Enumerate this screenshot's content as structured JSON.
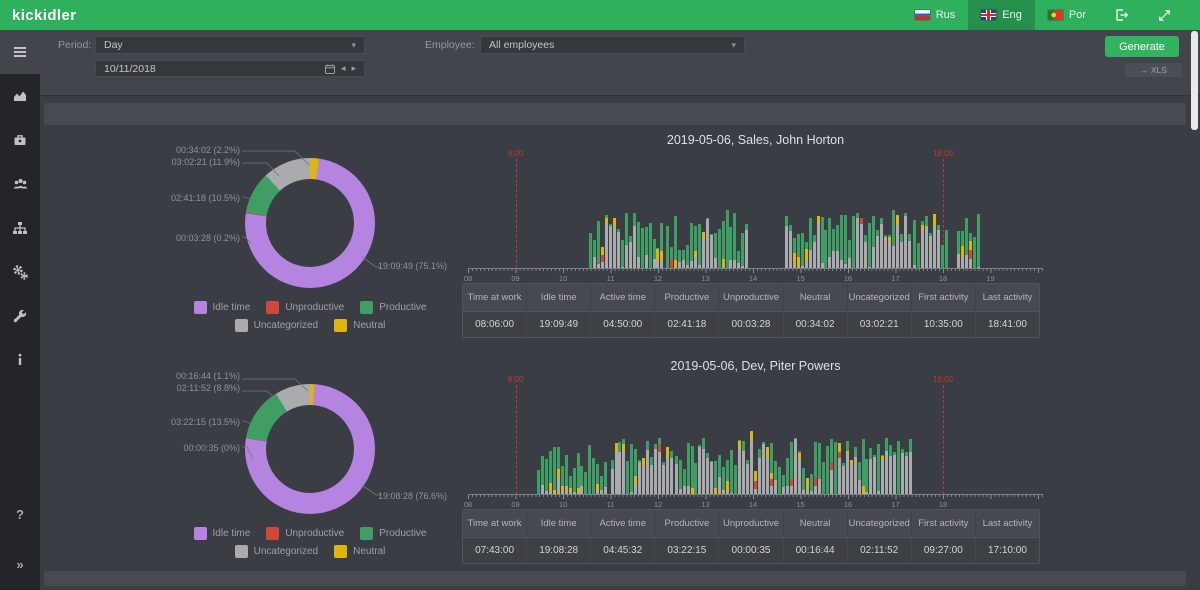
{
  "header": {
    "logo": "kickidler",
    "languages": [
      {
        "label": "Rus",
        "active": false
      },
      {
        "label": "Eng",
        "active": true
      },
      {
        "label": "Por",
        "active": false
      }
    ]
  },
  "sidebar": {
    "items": [
      {
        "name": "reports",
        "active": true
      },
      {
        "name": "charts",
        "active": false
      },
      {
        "name": "violations",
        "active": false
      },
      {
        "name": "employees",
        "active": false
      },
      {
        "name": "structure",
        "active": false
      },
      {
        "name": "settings",
        "active": false
      },
      {
        "name": "tools",
        "active": false
      },
      {
        "name": "info",
        "active": false
      }
    ],
    "help_glyph": "?",
    "collapse_glyph": "»"
  },
  "filters": {
    "period_label": "Period:",
    "period_value": "Day",
    "date_value": "10/11/2018",
    "employee_label": "Employee:",
    "employee_value": "All employees",
    "generate_label": "Generate",
    "xls_label": "→ XLS",
    "date_prev": "◂",
    "date_next": "▸"
  },
  "legend": {
    "items": [
      {
        "label": "Idle time",
        "color": "#b584e0"
      },
      {
        "label": "Unproductive",
        "color": "#d0483a"
      },
      {
        "label": "Productive",
        "color": "#3f9e63"
      },
      {
        "label": "Uncategorized",
        "color": "#a9abad"
      },
      {
        "label": "Neutral",
        "color": "#dcb50e"
      }
    ]
  },
  "reports": [
    {
      "title": "2019-05-06, Sales, John Horton",
      "callouts": [
        "00:34:02 (2.2%)",
        "03:02:21 (11.9%)",
        "02:41:18 (10.5%)",
        "00:03:28 (0.2%)",
        "19:09:49 (75.1%)"
      ],
      "table": {
        "headers": [
          "Time at work",
          "Idle time",
          "Active time",
          "Productive",
          "Unproductive",
          "Neutral",
          "Uncategorized",
          "First activity",
          "Last activity"
        ],
        "values": [
          "08:06:00",
          "19:09:49",
          "04:50:00",
          "02:41:18",
          "00:03:28",
          "00:34:02",
          "03:02:21",
          "10:35:00",
          "18:41:00"
        ]
      }
    },
    {
      "title": "2019-05-06, Dev, Piter Powers",
      "callouts": [
        "00:16:44 (1.1%)",
        "02:11:52 (8.8%)",
        "03:22:15 (13.5%)",
        "00:00:35 (0%)",
        "19:08:28 (76.6%)"
      ],
      "table": {
        "headers": [
          "Time at work",
          "Idle time",
          "Active time",
          "Productive",
          "Unproductive",
          "Neutral",
          "Uncategorized",
          "First activity",
          "Last activity"
        ],
        "values": [
          "07:43:00",
          "19:08:28",
          "04:45:32",
          "03:22:15",
          "00:00:35",
          "00:16:44",
          "02:11:52",
          "09:27:00",
          "17:10:00"
        ]
      }
    }
  ],
  "chart_data": [
    {
      "type": "pie",
      "donut": true,
      "title": "2019-05-06, Sales, John Horton — working time distribution",
      "labels": [
        "Neutral",
        "Idle time",
        "Unproductive",
        "Productive",
        "Uncategorized"
      ],
      "values_pct": [
        2.2,
        75.1,
        0.2,
        10.5,
        11.9
      ],
      "values_time": [
        "00:34:02",
        "19:09:49",
        "00:03:28",
        "02:41:18",
        "03:02:21"
      ],
      "colors": [
        "#dcb50e",
        "#b584e0",
        "#d0483a",
        "#3f9e63",
        "#a9abad"
      ],
      "legend_position": "bottom"
    },
    {
      "type": "bar",
      "subtype": "stacked-activity-timeline",
      "title": "2019-05-06, Sales, John Horton — activity by time of day",
      "x_axis": {
        "start": 8,
        "end": 20,
        "hour_labels": [
          "08",
          "09",
          "10",
          "11",
          "12",
          "13",
          "14",
          "15",
          "16",
          "17",
          "18",
          "19"
        ]
      },
      "bar_interval_min": 5,
      "activity_hours": [
        [
          10.55,
          12.08
        ],
        [
          12.17,
          13.92
        ],
        [
          14.67,
          17.28
        ],
        [
          17.37,
          18.05
        ],
        [
          18.3,
          18.72
        ]
      ],
      "schedule_lines": [
        {
          "hour": 9,
          "label": "9:00"
        },
        {
          "hour": 18,
          "label": "18:00"
        }
      ],
      "series_colors": {
        "productive": "#3f9e63",
        "uncategorized": "#a9abad",
        "neutral": "#dcb50e",
        "unproductive": "#d0483a"
      },
      "seed": 42
    },
    {
      "type": "pie",
      "donut": true,
      "title": "2019-05-06, Dev, Piter Powers — working time distribution",
      "labels": [
        "Neutral",
        "Idle time",
        "Unproductive",
        "Productive",
        "Uncategorized"
      ],
      "values_pct": [
        1.1,
        76.6,
        0.1,
        13.5,
        8.8
      ],
      "values_time": [
        "00:16:44",
        "19:08:28",
        "00:00:35",
        "03:22:15",
        "02:11:52"
      ],
      "colors": [
        "#dcb50e",
        "#b584e0",
        "#d0483a",
        "#3f9e63",
        "#a9abad"
      ],
      "legend_position": "bottom"
    },
    {
      "type": "bar",
      "subtype": "stacked-activity-timeline",
      "title": "2019-05-06, Dev, Piter Powers — activity by time of day",
      "x_axis": {
        "start": 8,
        "end": 20,
        "hour_labels": [
          "08",
          "09",
          "10",
          "11",
          "12",
          "13",
          "14",
          "15",
          "16",
          "17",
          "18"
        ]
      },
      "bar_interval_min": 5,
      "activity_hours": [
        [
          9.45,
          10.92
        ],
        [
          11.0,
          12.28
        ],
        [
          12.35,
          14.2
        ],
        [
          14.28,
          15.62
        ],
        [
          15.7,
          17.3
        ]
      ],
      "schedule_lines": [
        {
          "hour": 9,
          "label": "9:00"
        },
        {
          "hour": 18,
          "label": "18:00"
        }
      ],
      "series_colors": {
        "productive": "#3f9e63",
        "uncategorized": "#a9abad",
        "neutral": "#dcb50e",
        "unproductive": "#d0483a"
      },
      "seed": 1337
    }
  ]
}
